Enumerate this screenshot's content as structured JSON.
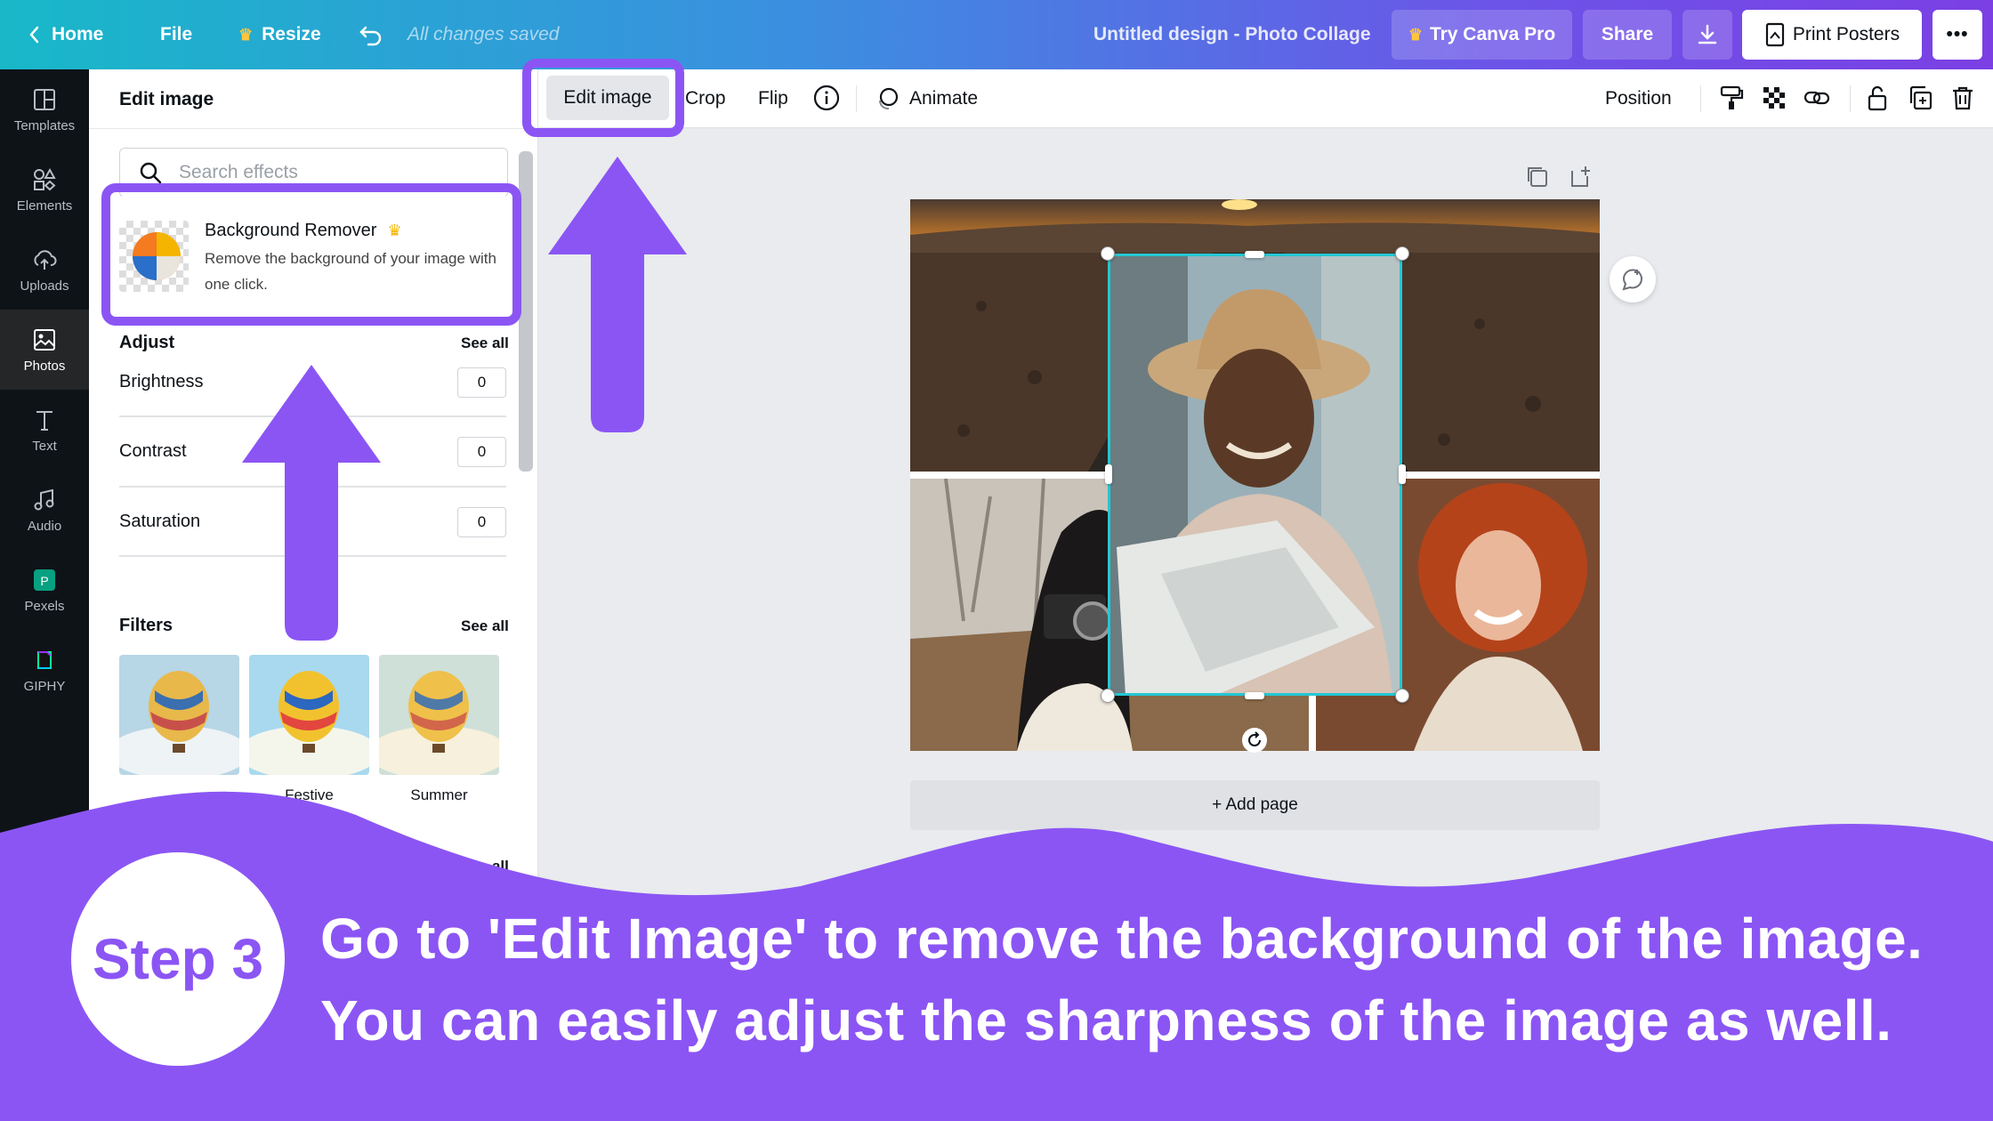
{
  "topbar": {
    "home": "Home",
    "file": "File",
    "resize": "Resize",
    "saved_status": "All changes saved",
    "design_title": "Untitled design - Photo Collage",
    "try_pro": "Try Canva Pro",
    "share": "Share",
    "print": "Print Posters",
    "more": "•••",
    "gradient_colors": [
      "#18b8c8",
      "#3b8fe0",
      "#7b3fe4"
    ]
  },
  "rail": {
    "items": [
      {
        "label": "Templates",
        "icon": "templates-icon"
      },
      {
        "label": "Elements",
        "icon": "elements-icon"
      },
      {
        "label": "Uploads",
        "icon": "uploads-icon"
      },
      {
        "label": "Photos",
        "icon": "photos-icon",
        "active": true
      },
      {
        "label": "Text",
        "icon": "text-icon"
      },
      {
        "label": "Audio",
        "icon": "audio-icon"
      },
      {
        "label": "Pexels",
        "icon": "pexels-icon"
      },
      {
        "label": "GIPHY",
        "icon": "giphy-icon"
      }
    ]
  },
  "panel": {
    "title": "Edit image",
    "search_placeholder": "Search effects",
    "bg_remover": {
      "title": "Background Remover",
      "description": "Remove the background of your image with one click."
    },
    "adjust": {
      "title": "Adjust",
      "see_all": "See all",
      "items": [
        {
          "label": "Brightness",
          "value": "0"
        },
        {
          "label": "Contrast",
          "value": "0"
        },
        {
          "label": "Saturation",
          "value": "0"
        }
      ]
    },
    "filters": {
      "title": "Filters",
      "see_all": "See all",
      "items": [
        {
          "label": ""
        },
        {
          "label": "Festive"
        },
        {
          "label": "Summer"
        }
      ]
    },
    "effects_see_all": "See all"
  },
  "context_toolbar": {
    "edit_image": "Edit image",
    "crop": "Crop",
    "flip": "Flip",
    "animate": "Animate",
    "position": "Position"
  },
  "canvas": {
    "add_page": "+ Add page"
  },
  "banner": {
    "step": "Step 3",
    "line1": "Go to 'Edit Image' to remove the background of the image.",
    "line2": "You can easily adjust the sharpness of the image as well.",
    "accent_color": "#8b55f4"
  }
}
